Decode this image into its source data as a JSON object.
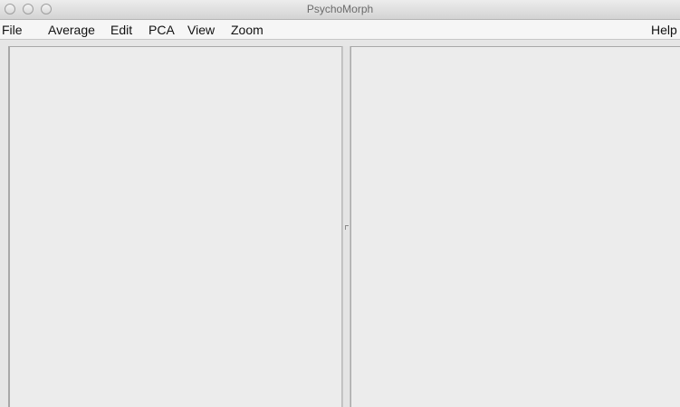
{
  "window": {
    "title": "PsychoMorph"
  },
  "menubar": {
    "items": [
      {
        "label": "File"
      },
      {
        "label": "Average"
      },
      {
        "label": "Edit"
      },
      {
        "label": "PCA"
      },
      {
        "label": "View"
      },
      {
        "label": "Zoom"
      }
    ],
    "help_label": "Help"
  },
  "icons": {
    "close": "close-icon",
    "minimize": "minimize-icon",
    "zoom": "zoom-icon",
    "divider_grip": "grip-icon"
  },
  "colors": {
    "window_background": "#ececec",
    "menubar_background": "#f6f6f6",
    "titlebar_text": "#6b6b6b"
  }
}
